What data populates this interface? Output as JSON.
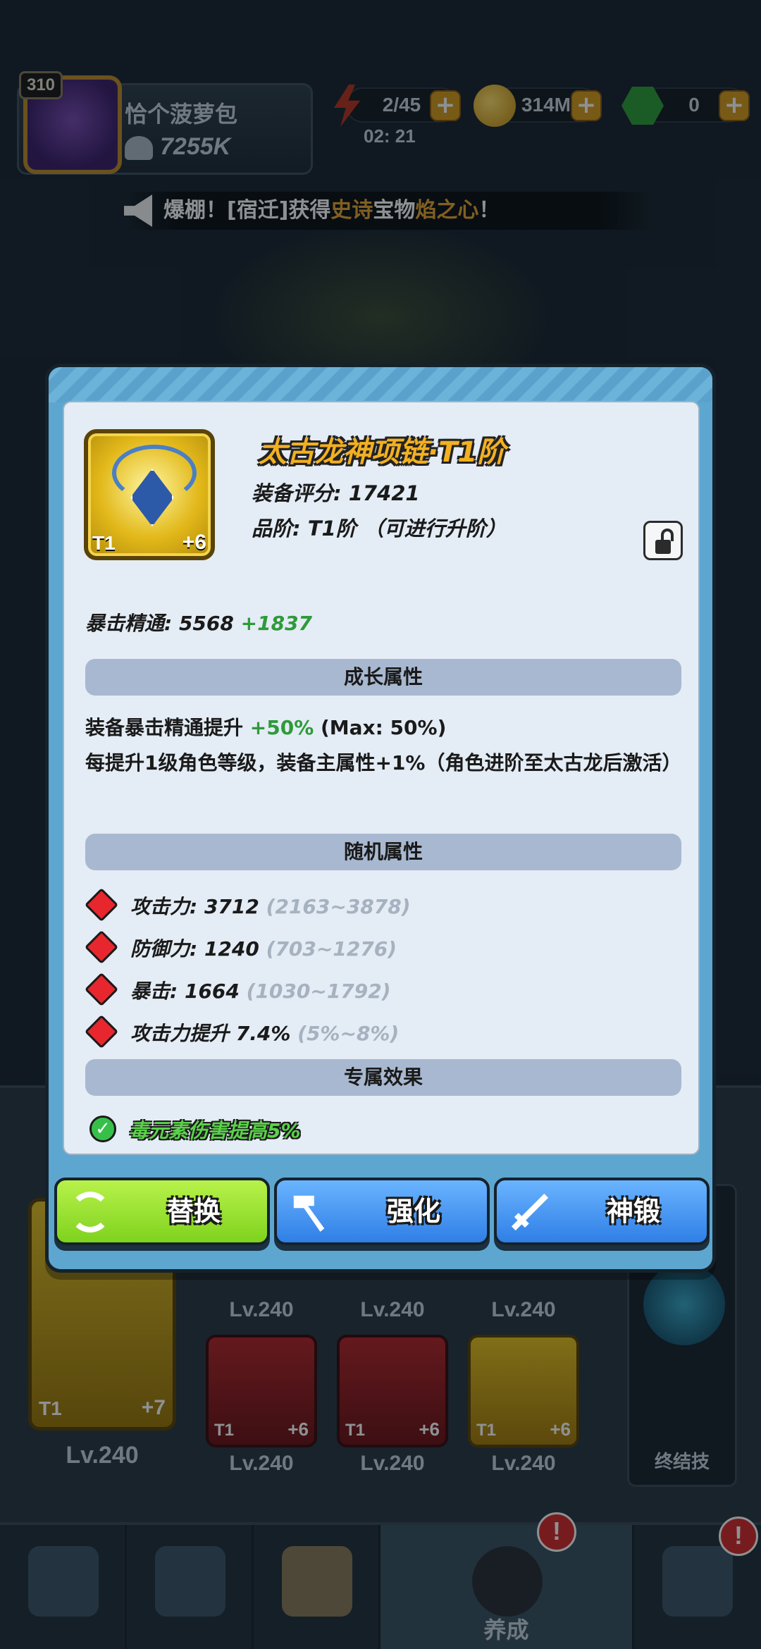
{
  "hud": {
    "player_level": "310",
    "player_name": "恰个菠萝包",
    "power": "7255K",
    "energy": "2/45",
    "coins": "314M",
    "gems": "0",
    "timer": "02: 21"
  },
  "announcement": {
    "prefix": "爆棚！[宿迁]获得",
    "quality": "史诗",
    "middle": "宝物",
    "item": "焰之心",
    "suffix": "！"
  },
  "modal": {
    "item_name": "太古龙神项链·T1阶",
    "score_label": "装备评分: 17421",
    "grade_label": "品阶: T1阶 （可进行升阶）",
    "icon_tier": "T1",
    "icon_plus": "+6",
    "crit_mastery": {
      "label": "暴击精通:  5568",
      "bonus": "+1837"
    },
    "growth": {
      "title": "成长属性",
      "line1_prefix": "装备暴击精通提升",
      "line1_value": "+50%",
      "line1_suffix": "(Max: 50%)",
      "line2": "每提升1级角色等级，装备主属性+1%（角色进阶至太古龙后激活）"
    },
    "random": {
      "title": "随机属性",
      "rows": [
        {
          "label": "攻击力: 3712",
          "range": "(2163~3878)"
        },
        {
          "label": "防御力: 1240",
          "range": "(703~1276)"
        },
        {
          "label": "暴击: 1664",
          "range": "(1030~1792)"
        },
        {
          "label": "攻击力提升 7.4%",
          "range": "(5%~8%)"
        }
      ]
    },
    "exclusive": {
      "title": "专属效果",
      "effect": "毒元素伤害提高5%"
    },
    "buttons": {
      "replace": "替换",
      "enhance": "强化",
      "forge": "神锻"
    }
  },
  "background": {
    "main_weapon": {
      "tier": "T1",
      "plus": "+7",
      "level": "Lv.240"
    },
    "top_row_levels": [
      "Lv.240",
      "Lv.240",
      "Lv.240"
    ],
    "cards": [
      {
        "tier": "T1",
        "plus": "+6",
        "level": "Lv.240"
      },
      {
        "tier": "T1",
        "plus": "+6",
        "level": "Lv.240"
      },
      {
        "tier": "T1",
        "plus": "+6",
        "level": "Lv.240"
      }
    ],
    "ultimate_label": "终结技"
  },
  "nav": {
    "active_label": "养成",
    "alert": "!"
  }
}
